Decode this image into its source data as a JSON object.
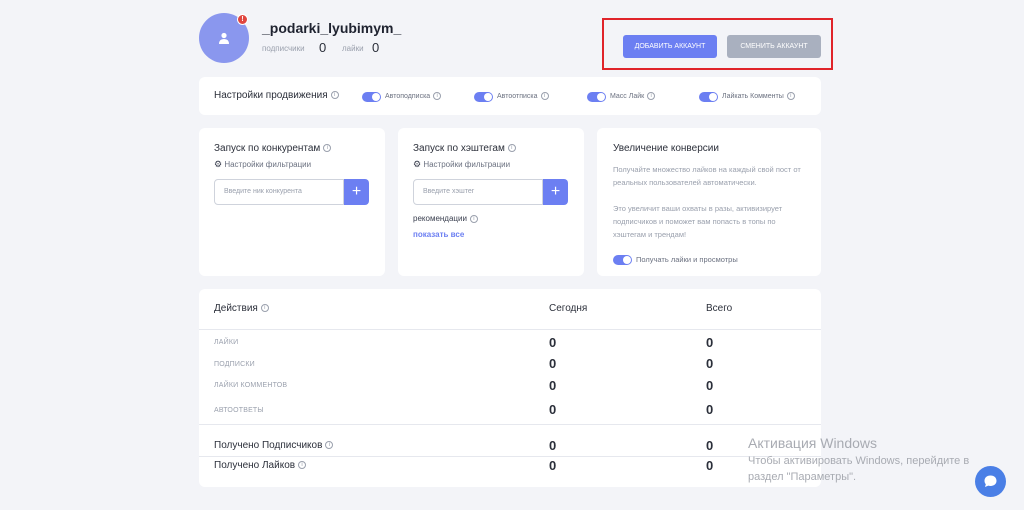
{
  "profile": {
    "username": "_podarki_lyubimym_",
    "followers_label": "подписчики",
    "followers_count": "0",
    "likes_label": "лайки",
    "likes_count": "0",
    "notification_badge": "!"
  },
  "actions": {
    "add_account_label": "ДОБАВИТЬ АККАУНТ",
    "switch_account_label": "СМЕНИТЬ АККАУНТ"
  },
  "promotion": {
    "title": "Настройки продвижения",
    "toggles": [
      {
        "label": "Автоподписка",
        "on": true
      },
      {
        "label": "Автоотписка",
        "on": true
      },
      {
        "label": "Масс Лайк",
        "on": true
      },
      {
        "label": "Лайкать Комменты",
        "on": true
      }
    ]
  },
  "competitors": {
    "title": "Запуск по конкурентам",
    "filter_settings": "Настройки фильтрации",
    "input_placeholder": "Введите ник конкурента",
    "add_symbol": "+"
  },
  "hashtags": {
    "title": "Запуск по хэштегам",
    "filter_settings": "Настройки фильтрации",
    "input_placeholder": "Введите хэштег",
    "add_symbol": "+",
    "recommendations_label": "рекомендации",
    "show_all_link": "показать все"
  },
  "conversion": {
    "title": "Увеличение конверсии",
    "description_1": "Получайте множество лайков на каждый свой пост от реальных пользователей автоматически.",
    "description_2": "Это увеличит ваши охваты в разы, активизирует подписчиков и поможет вам попасть в топы по хэштегам и трендам!",
    "toggle_label": "Получать лайки и просмотры"
  },
  "stats": {
    "col_actions": "Действия",
    "col_today": "Сегодня",
    "col_total": "Всего",
    "rows": [
      {
        "label": "лайки",
        "today": "0",
        "total": "0"
      },
      {
        "label": "подписки",
        "today": "0",
        "total": "0"
      },
      {
        "label": "лайки комментов",
        "today": "0",
        "total": "0"
      },
      {
        "label": "автоответы",
        "today": "0",
        "total": "0"
      }
    ],
    "received_followers_label": "Получено Подписчиков",
    "received_followers_today": "0",
    "received_followers_total": "0",
    "received_likes_label": "Получено Лайков",
    "received_likes_today": "0",
    "received_likes_total": "0"
  },
  "watermark": {
    "title": "Активация Windows",
    "line1": "Чтобы активировать Windows, перейдите в",
    "line2": "раздел \"Параметры\"."
  },
  "colors": {
    "accent": "#6c7ff2",
    "switch_button": "#a9b0bf",
    "highlight_border": "#e0242a",
    "badge": "#e0463f"
  },
  "icons": {
    "avatar": "user-icon",
    "filter": "gear-icon",
    "chat": "chat-bubble-icon"
  }
}
